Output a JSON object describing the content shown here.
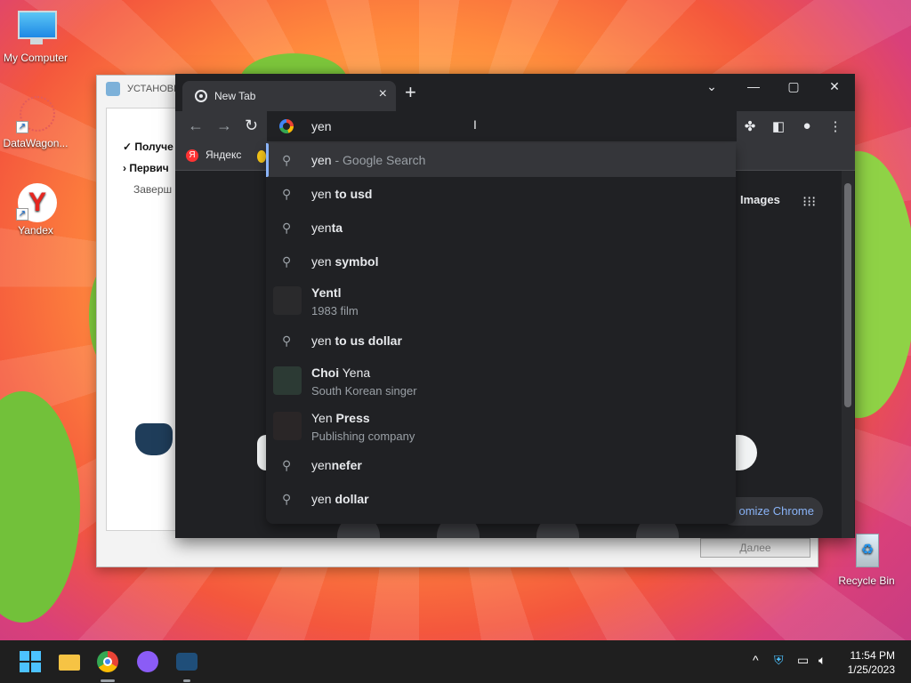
{
  "desktop": {
    "icons": [
      {
        "label": "My Computer",
        "icon": "monitor-icon"
      },
      {
        "label": "DataWagon...",
        "icon": "datawagon-icon"
      },
      {
        "label": "Yandex",
        "icon": "yandex-icon"
      },
      {
        "label": "Recycle Bin",
        "icon": "recycle-bin-icon"
      }
    ]
  },
  "installer": {
    "title": "УСТАНОВК",
    "steps": [
      "Получе",
      "Первич",
      "Заверш"
    ],
    "next_label": "Далее"
  },
  "chrome": {
    "tab_title": "New Tab",
    "omnibox_value": "yen",
    "bookmark_label": "Яндекс",
    "images_label": "Images",
    "customize_label": "omize Chrome"
  },
  "suggestions": [
    {
      "prefix": "yen",
      "bold": "",
      "suffix": " - Google Search",
      "type": "search"
    },
    {
      "prefix": "yen",
      "bold": " to usd",
      "type": "search"
    },
    {
      "prefix": "yen",
      "bold": "ta",
      "type": "search"
    },
    {
      "prefix": "yen",
      "bold": " symbol",
      "type": "search"
    },
    {
      "prefix": "Yen",
      "bold": "tl",
      "sub": "1983 film",
      "type": "entity",
      "thumb_color": "#2a2a2c"
    },
    {
      "prefix": "yen",
      "bold": " to us dollar",
      "type": "search"
    },
    {
      "prefix": "Choi ",
      "bold_first": "Choi",
      "plain": " Yena",
      "sub": "South Korean singer",
      "type": "entity",
      "thumb_color": "#2c3a34"
    },
    {
      "prefix": "Yen ",
      "bold": "Press",
      "sub": "Publishing company",
      "type": "entity",
      "thumb_color": "#2a2627"
    },
    {
      "prefix": "yen",
      "bold": "nefer",
      "type": "search"
    },
    {
      "prefix": "yen",
      "bold": " dollar",
      "type": "search"
    }
  ],
  "taskbar": {
    "time": "11:54 PM",
    "date": "1/25/2023"
  }
}
